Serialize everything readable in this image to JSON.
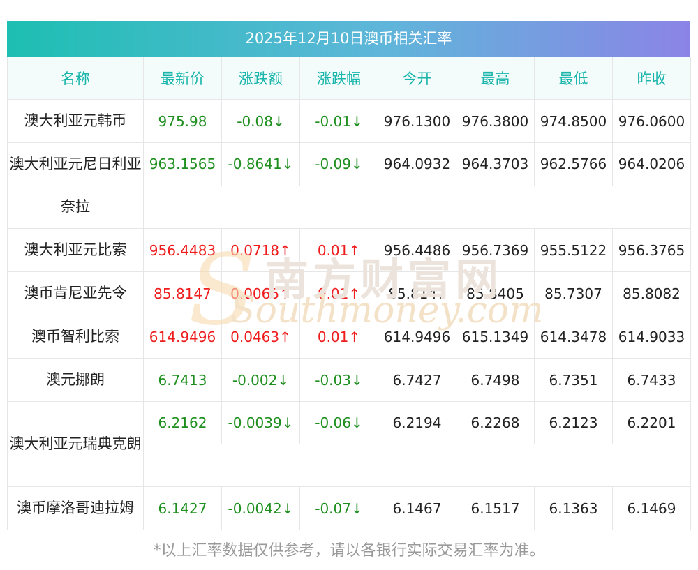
{
  "title": "2025年12月10日澳币相关汇率",
  "headers": [
    "名称",
    "最新价",
    "涨跌额",
    "涨跌幅",
    "今开",
    "最高",
    "最低",
    "昨收"
  ],
  "rows": [
    {
      "name": "澳大利亚元韩币",
      "latest": "975.98",
      "change": "-0.08↓",
      "pct": "-0.01↓",
      "open": "976.1300",
      "high": "976.3800",
      "low": "974.8500",
      "prev": "976.0600"
    },
    {
      "name": "澳大利亚元尼日利亚奈拉",
      "latest": "963.1565",
      "change": "-0.8641↓",
      "pct": "-0.09↓",
      "open": "964.0932",
      "high": "964.3703",
      "low": "962.5766",
      "prev": "964.0206"
    },
    {
      "name": "澳大利亚元比索",
      "latest": "956.4483",
      "change": "0.0718↑",
      "pct": "0.01↑",
      "open": "956.4486",
      "high": "956.7369",
      "low": "955.5122",
      "prev": "956.3765"
    },
    {
      "name": "澳币肯尼亚先令",
      "latest": "85.8147",
      "change": "0.0065↑",
      "pct": "0.01↑",
      "open": "85.8147",
      "high": "85.8405",
      "low": "85.7307",
      "prev": "85.8082"
    },
    {
      "name": "澳币智利比索",
      "latest": "614.9496",
      "change": "0.0463↑",
      "pct": "0.01↑",
      "open": "614.9496",
      "high": "615.1349",
      "low": "614.3478",
      "prev": "614.9033"
    },
    {
      "name": "澳元挪朗",
      "latest": "6.7413",
      "change": "-0.002↓",
      "pct": "-0.03↓",
      "open": "6.7427",
      "high": "6.7498",
      "low": "6.7351",
      "prev": "6.7433"
    },
    {
      "name": "澳大利亚元瑞典克朗",
      "latest": "6.2162",
      "change": "-0.0039↓",
      "pct": "-0.06↓",
      "open": "6.2194",
      "high": "6.2268",
      "low": "6.2123",
      "prev": "6.2201"
    },
    {
      "name": "澳币摩洛哥迪拉姆",
      "latest": "6.1427",
      "change": "-0.0042↓",
      "pct": "-0.07↓",
      "open": "6.1467",
      "high": "6.1517",
      "low": "6.1363",
      "prev": "6.1469"
    }
  ],
  "footnote": "*以上汇率数据仅供参考，请以各银行实际交易汇率为准。",
  "watermark": {
    "cn": "南方财富网",
    "en": "Southmoney.com"
  },
  "colors": {
    "up": "#ee1c1c",
    "down": "#1e8f1e",
    "header_text": "#19b5ab",
    "title_gradient_start": "#1dbfb2",
    "title_gradient_end": "#8b84e6"
  }
}
